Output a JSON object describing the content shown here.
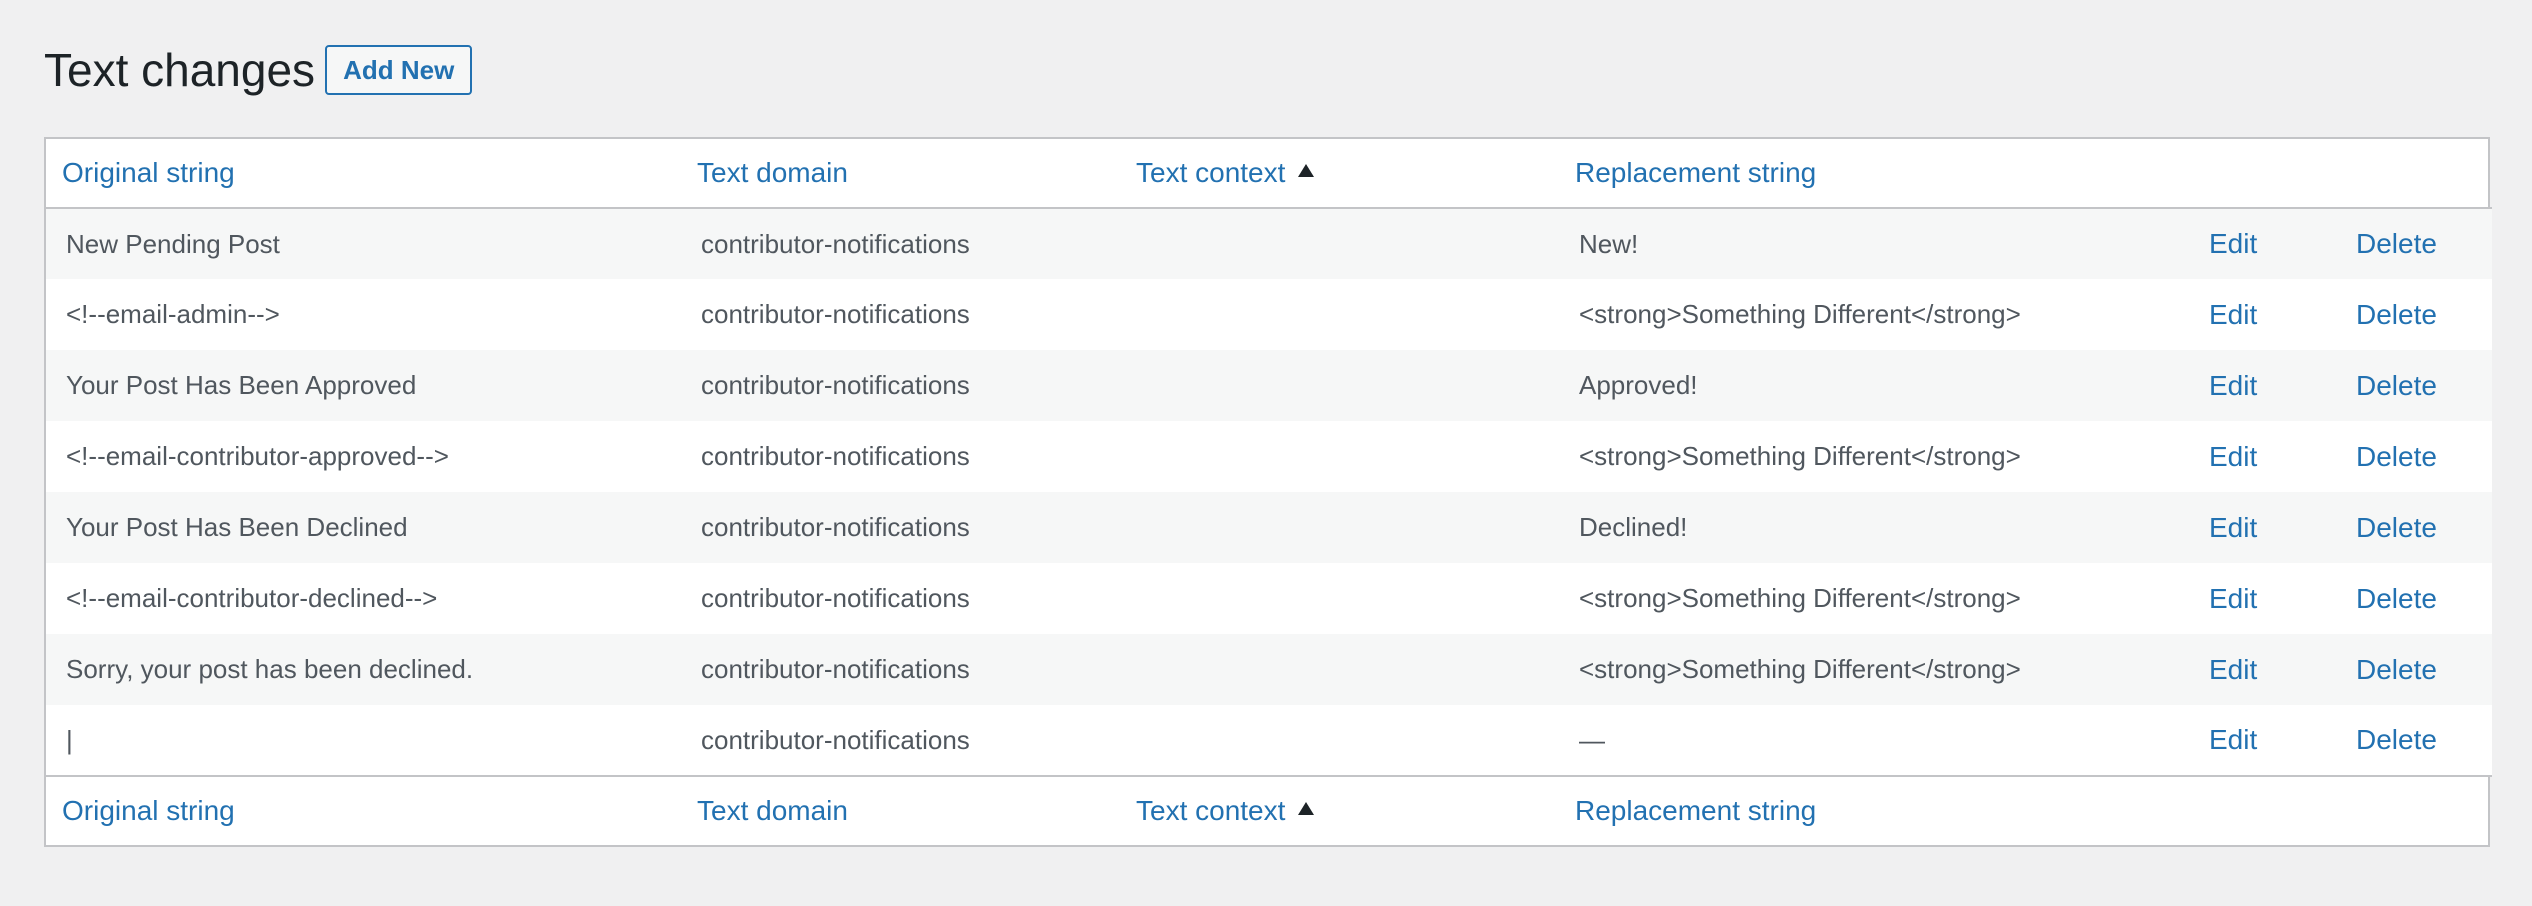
{
  "page": {
    "title": "Text changes",
    "add_new_label": "Add New"
  },
  "table": {
    "columns": {
      "original": "Original string",
      "domain": "Text domain",
      "context": "Text context",
      "replacement": "Replacement string"
    },
    "actions": {
      "edit": "Edit",
      "delete": "Delete"
    },
    "rows": [
      {
        "original": "New Pending Post",
        "domain": "contributor-notifications",
        "context": "",
        "replacement": "New!"
      },
      {
        "original": "<!--email-admin-->",
        "domain": "contributor-notifications",
        "context": "",
        "replacement": "<strong>Something Different</strong>"
      },
      {
        "original": "Your Post Has Been Approved",
        "domain": "contributor-notifications",
        "context": "",
        "replacement": "Approved!"
      },
      {
        "original": "<!--email-contributor-approved-->",
        "domain": "contributor-notifications",
        "context": "",
        "replacement": "<strong>Something Different</strong>"
      },
      {
        "original": "Your Post Has Been Declined",
        "domain": "contributor-notifications",
        "context": "",
        "replacement": "Declined!"
      },
      {
        "original": "<!--email-contributor-declined-->",
        "domain": "contributor-notifications",
        "context": "",
        "replacement": "<strong>Something Different</strong>"
      },
      {
        "original": "Sorry, your post has been declined.",
        "domain": "contributor-notifications",
        "context": "",
        "replacement": "<strong>Something Different</strong>"
      },
      {
        "original": "|",
        "domain": "contributor-notifications",
        "context": "",
        "replacement": "—"
      }
    ]
  }
}
